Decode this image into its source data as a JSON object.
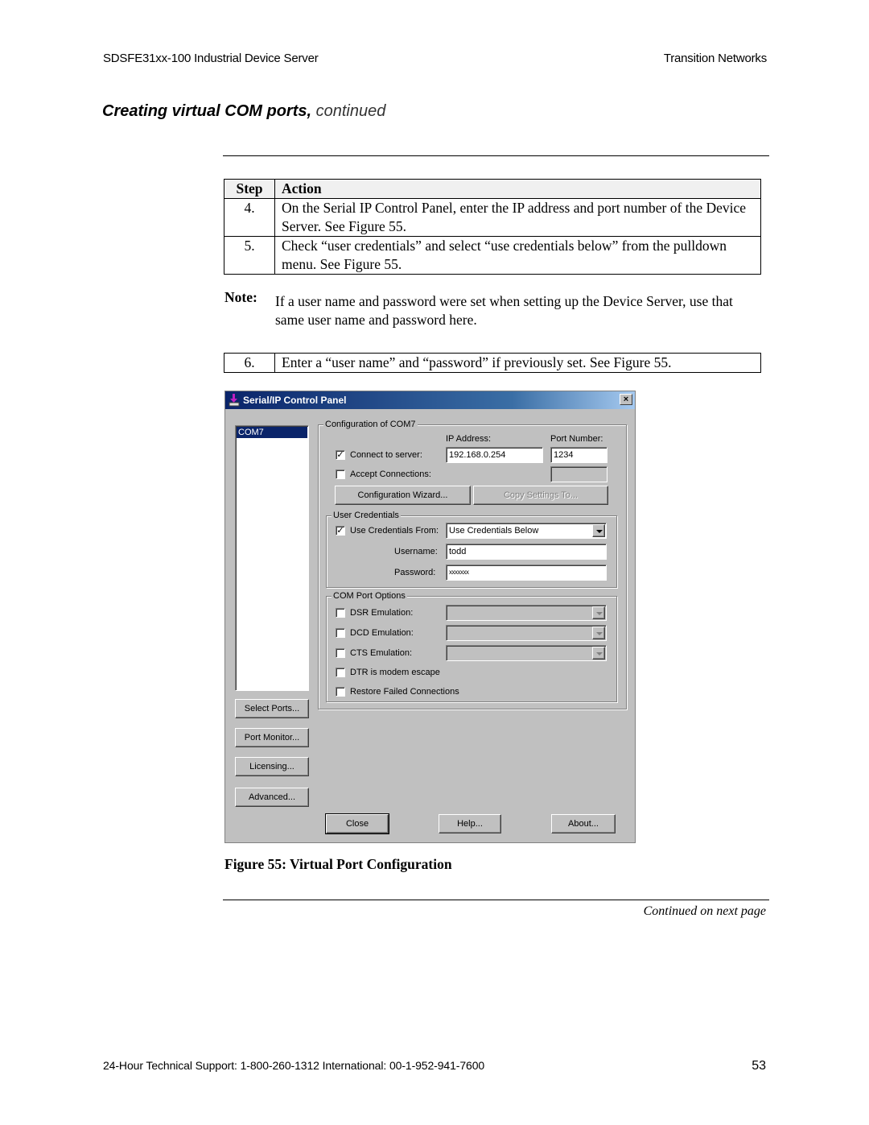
{
  "header": {
    "doc_title": "SDSFE31xx-100 Industrial Device Server",
    "company": "Transition Networks"
  },
  "section": {
    "title": "Creating virtual COM ports,",
    "suffix": "continued"
  },
  "steps_table": {
    "headers": [
      "Step",
      "Action"
    ],
    "rows": [
      {
        "step": "4.",
        "action": "On the Serial IP Control Panel, enter the IP address and port number of the Device Server. See Figure 55."
      },
      {
        "step": "5.",
        "action": "Check “user credentials” and select “use credentials below” from the pulldown menu. See Figure 55."
      }
    ]
  },
  "note": {
    "label": "Note:",
    "text": "If a user name and password were set when setting up the Device Server, use that same user name and password here."
  },
  "steps_table_2": {
    "rows": [
      {
        "step": "6.",
        "action": "Enter a “user name” and “password” if previously set. See Figure 55."
      }
    ]
  },
  "dialog": {
    "title": "Serial/IP Control Panel",
    "close_glyph": "×",
    "com_list": [
      "COM7"
    ],
    "config_group": {
      "legend": "Configuration of COM7",
      "ip_label": "IP Address:",
      "port_label": "Port Number:",
      "connect_label": "Connect to server:",
      "connect_checked": true,
      "accept_label": "Accept Connections:",
      "accept_checked": false,
      "ip_value": "192.168.0.254",
      "port_value": "1234",
      "accept_port_value": "",
      "wizard_button": "Configuration Wizard...",
      "copy_button": "Copy Settings To..."
    },
    "credentials_group": {
      "legend": "User Credentials",
      "use_from_label": "Use Credentials From:",
      "use_from_checked": true,
      "use_from_value": "Use Credentials Below",
      "username_label": "Username:",
      "username_value": "todd",
      "password_label": "Password:",
      "password_value": "xxxxxxx"
    },
    "com_options_group": {
      "legend": "COM Port Options",
      "options": [
        {
          "label": "DSR Emulation:",
          "checked": false,
          "has_combo": true,
          "combo_value": ""
        },
        {
          "label": "DCD Emulation:",
          "checked": false,
          "has_combo": true,
          "combo_value": ""
        },
        {
          "label": "CTS Emulation:",
          "checked": false,
          "has_combo": true,
          "combo_value": ""
        },
        {
          "label": "DTR is modem escape",
          "checked": false,
          "has_combo": false
        },
        {
          "label": "Restore Failed Connections",
          "checked": false,
          "has_combo": false
        }
      ]
    },
    "side_buttons": [
      "Select Ports...",
      "Port Monitor...",
      "Licensing...",
      "Advanced..."
    ],
    "bottom_buttons": [
      "Close",
      "Help...",
      "About..."
    ]
  },
  "figure": {
    "caption": "Figure 55:  Virtual Port Configuration"
  },
  "continued_note": "Continued on next page",
  "footer": {
    "support": "24-Hour Technical Support:   1-800-260-1312   International: 00-1-952-941-7600",
    "page_number": "53"
  }
}
